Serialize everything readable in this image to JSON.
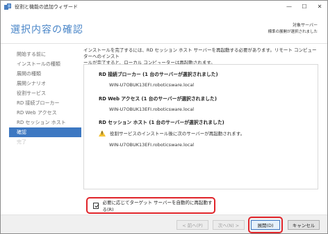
{
  "window": {
    "title": "役割と機能の追加ウィザード",
    "minimize_glyph": "—",
    "maximize_glyph": "☐",
    "close_glyph": "✕"
  },
  "header": {
    "page_title": "選択内容の確認",
    "dest_label": "対象サーバー",
    "dest_value": "標準の展開が選択されました"
  },
  "sidebar": {
    "items": [
      {
        "label": "開始する前に",
        "state": "normal"
      },
      {
        "label": "インストールの種類",
        "state": "normal"
      },
      {
        "label": "展開の種類",
        "state": "normal"
      },
      {
        "label": "展開シナリオ",
        "state": "normal"
      },
      {
        "label": "役割サービス",
        "state": "normal"
      },
      {
        "label": "RD 接続ブローカー",
        "state": "normal"
      },
      {
        "label": "RD Web アクセス",
        "state": "normal"
      },
      {
        "label": "RD セッション ホスト",
        "state": "normal"
      },
      {
        "label": "確認",
        "state": "active"
      },
      {
        "label": "完了",
        "state": "disabled"
      }
    ]
  },
  "content": {
    "description_line1": "インストールを完了するには、RD セッション ホスト サーバーを再起動する必要があります。リモート コンピューターへのインスト",
    "description_line2": "ールが完了すると、ローカル コンピューターは再起動されます。",
    "sections": [
      {
        "heading": "RD 接続ブローカー (1 台のサーバーが選択されました)",
        "server": "WIN-U7OBUK13EFI.roboticsware.local"
      },
      {
        "heading": "RD Web アクセス (1 台のサーバーが選択されました)",
        "server": "WIN-U7OBUK13EFI.roboticsware.local"
      },
      {
        "heading": "RD セッション ホスト (1 台のサーバーが選択されました)",
        "server": "WIN-U7OBUK13EFI.roboticsware.local"
      }
    ],
    "warning_text": "役割サービスのインストール後に次のサーバーが再起動されます。",
    "warning_icon": "warning-icon",
    "restart_checkbox_label": "必要に応じてターゲット サーバーを自動的に再起動する(R)",
    "restart_checked": true
  },
  "footer": {
    "prev_label": "< 前へ(P)",
    "next_label": "次へ(N) >",
    "deploy_label": "展開(D)",
    "cancel_label": "キャンセル"
  },
  "colors": {
    "accent": "#3d78c2",
    "title_blue": "#4a86c8",
    "highlight_red": "#e0242a",
    "warning_yellow": "#f4c233"
  }
}
